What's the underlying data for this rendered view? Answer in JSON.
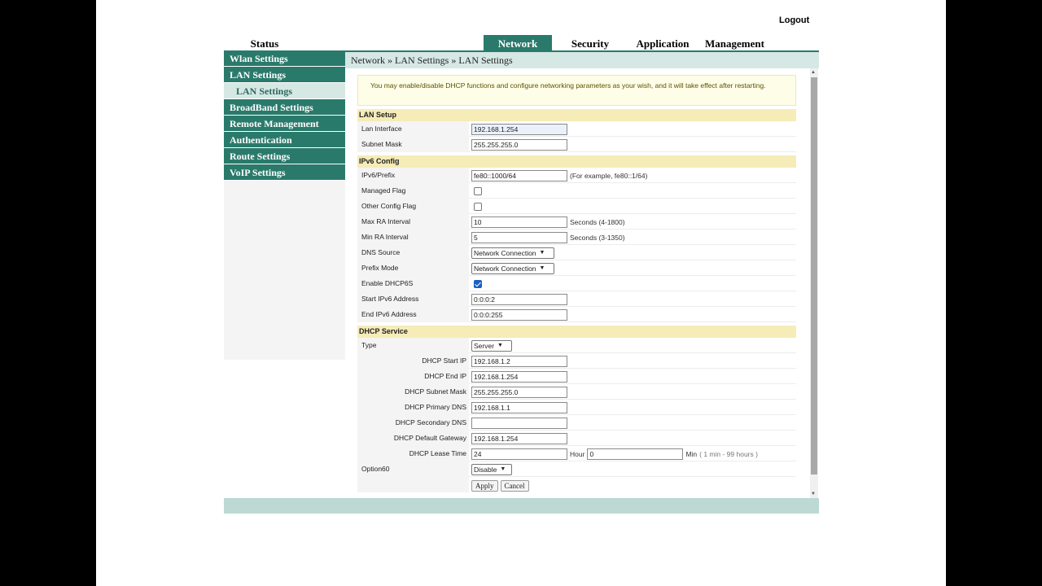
{
  "header": {
    "logout": "Logout"
  },
  "topnav": [
    "Status",
    "Network",
    "Security",
    "Application",
    "Management"
  ],
  "sidebar": {
    "items": [
      "Wlan Settings",
      "LAN Settings",
      "BroadBand Settings",
      "Remote Management",
      "Authentication",
      "Route Settings",
      "VoIP Settings"
    ],
    "sub": "LAN Settings"
  },
  "breadcrumb": "Network » LAN Settings » LAN Settings",
  "note": "You may enable/disable DHCP functions and configure networking parameters as your wish, and it will take effect after restarting.",
  "lan": {
    "title": "LAN Setup",
    "lan_interface_label": "Lan Interface",
    "lan_interface": "192.168.1.254",
    "subnet_label": "Subnet Mask",
    "subnet": "255.255.255.0"
  },
  "ipv6": {
    "title": "IPv6 Config",
    "prefix_label": "IPv6/Prefix",
    "prefix": "fe80::1000/64",
    "prefix_hint": "(For example, fe80::1/64)",
    "managed_label": "Managed Flag",
    "other_label": "Other Config Flag",
    "max_ra_label": "Max RA Interval",
    "max_ra": "10",
    "max_ra_hint": "Seconds (4-1800)",
    "min_ra_label": "Min RA Interval",
    "min_ra": "5",
    "min_ra_hint": "Seconds (3-1350)",
    "dns_label": "DNS Source",
    "dns": "Network Connection",
    "prefix_mode_label": "Prefix Mode",
    "prefix_mode": "Network Connection",
    "dhcp6s_label": "Enable DHCP6S",
    "start_label": "Start IPv6 Address",
    "start": "0:0:0:2",
    "end_label": "End IPv6 Address",
    "end": "0:0:0:255"
  },
  "dhcp": {
    "title": "DHCP Service",
    "type_label": "Type",
    "type": "Server",
    "start_label": "DHCP Start IP",
    "start": "192.168.1.2",
    "end_label": "DHCP End IP",
    "end": "192.168.1.254",
    "mask_label": "DHCP Subnet Mask",
    "mask": "255.255.255.0",
    "pdns_label": "DHCP Primary DNS",
    "pdns": "192.168.1.1",
    "sdns_label": "DHCP Secondary DNS",
    "sdns": "",
    "gw_label": "DHCP Default Gateway",
    "gw": "192.168.1.254",
    "lease_label": "DHCP Lease Time",
    "lease_hour": "24",
    "hour_unit": "Hour",
    "lease_min": "0",
    "min_unit": "Min",
    "lease_hint": "( 1 min - 99 hours )",
    "opt60_label": "Option60",
    "opt60": "Disable"
  },
  "buttons": {
    "apply": "Apply",
    "cancel": "Cancel"
  }
}
